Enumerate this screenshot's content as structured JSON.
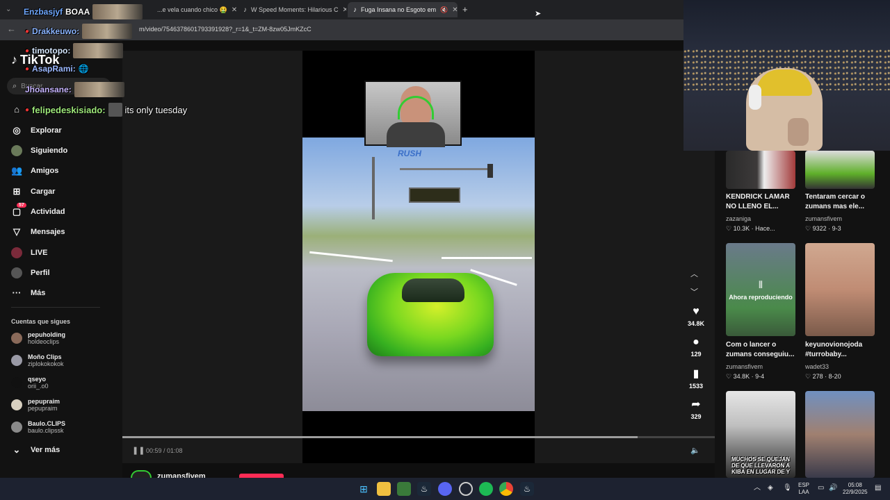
{
  "browser": {
    "tabs": [
      {
        "label": "...e vela cuando chico 🤮",
        "active": false
      },
      {
        "label": "W Speed Moments: Hilarious C",
        "active": false
      },
      {
        "label": "Fuga Insana no Esgoto em",
        "active": true
      }
    ],
    "url": "m/video/7546378601793391928?_r=1&_t=ZM-8zw05JmKZcC"
  },
  "chat": [
    {
      "user": "Enzbasjyf",
      "message": "BOAA",
      "color": "#6fa8ff"
    },
    {
      "user": "Drakkeuwo:",
      "message": "",
      "color": "#8ab4ff"
    },
    {
      "user": "timotopo:",
      "message": "",
      "color": "#d6e8ff"
    },
    {
      "user": "AsapRami:",
      "message": "",
      "color": "#9bb8ff"
    },
    {
      "user": "Jhoansane:",
      "message": "",
      "color": "#c6b4ff"
    },
    {
      "user": "felipedeskisiado:",
      "message": "its only tuesday",
      "color": "#9ee87a"
    }
  ],
  "sidebar": {
    "logo": "TikTok",
    "search_placeholder": "Buscar",
    "items": [
      {
        "label": "Explorar",
        "icon": "compass-icon"
      },
      {
        "label": "Siguiendo",
        "icon": "following-icon"
      },
      {
        "label": "Amigos",
        "icon": "friends-icon"
      },
      {
        "label": "Cargar",
        "icon": "upload-icon"
      },
      {
        "label": "Actividad",
        "icon": "activity-icon",
        "badge": "57"
      },
      {
        "label": "Mensajes",
        "icon": "messages-icon"
      },
      {
        "label": "LIVE",
        "icon": "live-icon"
      },
      {
        "label": "Perfil",
        "icon": "profile-icon"
      },
      {
        "label": "Más",
        "icon": "more-icon"
      }
    ],
    "following_header": "Cuentas que sigues",
    "following": [
      {
        "name": "pepuholding",
        "handle": "holdeoclips"
      },
      {
        "name": "Moño Clips",
        "handle": "ziplokokokok"
      },
      {
        "name": "qseyo",
        "handle": "orii_.o0"
      },
      {
        "name": "pepupraim",
        "handle": "pepupraim"
      },
      {
        "name": "Baulo.CLIPS",
        "handle": "baulo.clipssk"
      }
    ],
    "see_more": "Ver más"
  },
  "player": {
    "overlay_text": "RUSH",
    "current_time": "00:59",
    "duration": "01:08",
    "time_display": "00:59 / 01:08",
    "progress": 0.87,
    "author": "zumansfivem"
  },
  "actions": [
    {
      "icon": "heart-icon",
      "count": "34.8K"
    },
    {
      "icon": "comment-icon",
      "count": "129"
    },
    {
      "icon": "bookmark-icon",
      "count": "1533"
    },
    {
      "icon": "share-icon",
      "count": "329"
    }
  ],
  "recommended": [
    {
      "title": "KENDRICK LAMAR NO LLENO EL...",
      "author": "zazaniga",
      "likes": "10.3K",
      "date": "Hace..."
    },
    {
      "title": "Tentaram cercar o zumans mas ele...",
      "author": "zumansfivem",
      "likes": "9322",
      "date": "9-3"
    },
    {
      "title": "Com o lancer o zumans conseguiu...",
      "author": "zumansfivem",
      "likes": "34.8K",
      "date": "9-4",
      "overlay": "Ahora reproduciendo"
    },
    {
      "title": "keyunovionojoda #turrobaby...",
      "author": "wadet33",
      "likes": "278",
      "date": "8-20"
    },
    {
      "title": "",
      "author": "",
      "likes": "",
      "date": "",
      "caption": "MUCHOS SE QUEJAN DE QUE LLEVARON A KIBA EN LUGAR DE Y"
    },
    {
      "title": "",
      "author": "",
      "likes": "",
      "date": ""
    }
  ],
  "taskbar": {
    "lang": "ESP",
    "lang2": "LAA",
    "time": "05:08",
    "date": "22/9/2025"
  },
  "colors": {
    "accent_red": "#fe2c55",
    "bg": "#0f0f0f"
  }
}
